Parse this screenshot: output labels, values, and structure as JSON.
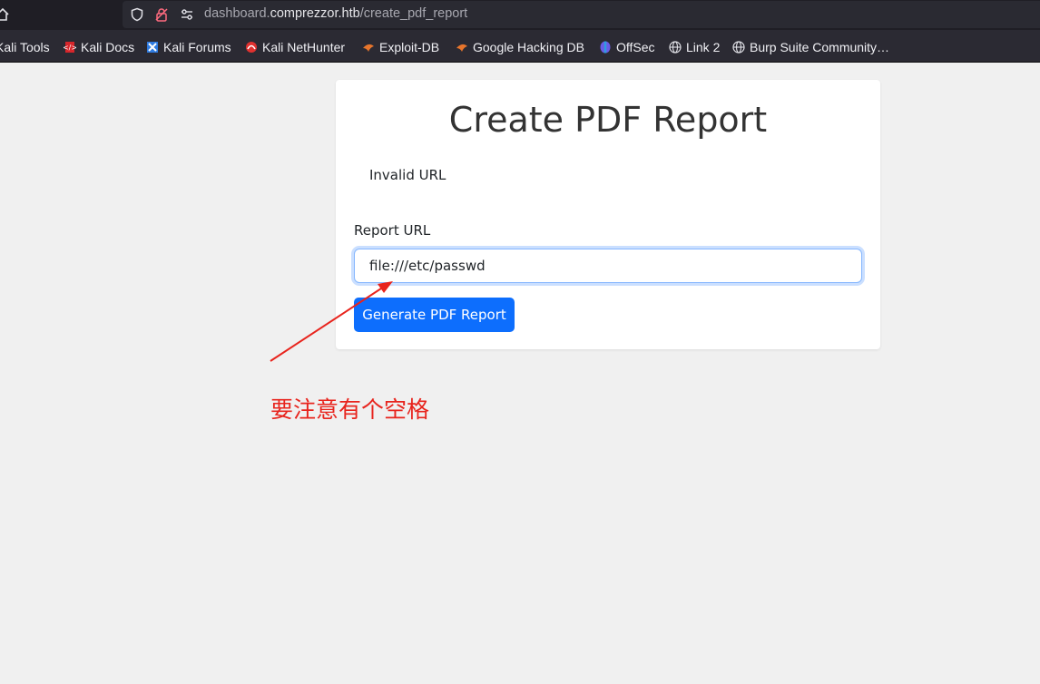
{
  "browser": {
    "url_prefix": "dashboard.",
    "url_domain": "comprezzor.htb",
    "url_path": "/create_pdf_report",
    "bookmarks": [
      {
        "label": "Kali Tools",
        "icon": "kali-icon"
      },
      {
        "label": "Kali Docs",
        "icon": "kali-docs-icon"
      },
      {
        "label": "Kali Forums",
        "icon": "kali-forums-icon"
      },
      {
        "label": "Kali NetHunter",
        "icon": "nethunter-icon"
      },
      {
        "label": "Exploit-DB",
        "icon": "exploit-db-icon"
      },
      {
        "label": "Google Hacking DB",
        "icon": "ghdb-icon"
      },
      {
        "label": "OffSec",
        "icon": "offsec-icon"
      },
      {
        "label": "Link 2",
        "icon": "globe-icon"
      },
      {
        "label": "Burp Suite Community…",
        "icon": "globe-icon"
      }
    ]
  },
  "page": {
    "title": "Create PDF Report",
    "message": "Invalid URL",
    "field_label": "Report URL",
    "field_value": "file:///etc/passwd",
    "submit_label": "Generate PDF Report"
  },
  "annotation": {
    "text": "要注意有个空格",
    "color": "#e8241d"
  },
  "colors": {
    "primary": "#0d6efd",
    "page_bg": "#f0f0f0",
    "chrome_bg": "#1f1e25"
  }
}
